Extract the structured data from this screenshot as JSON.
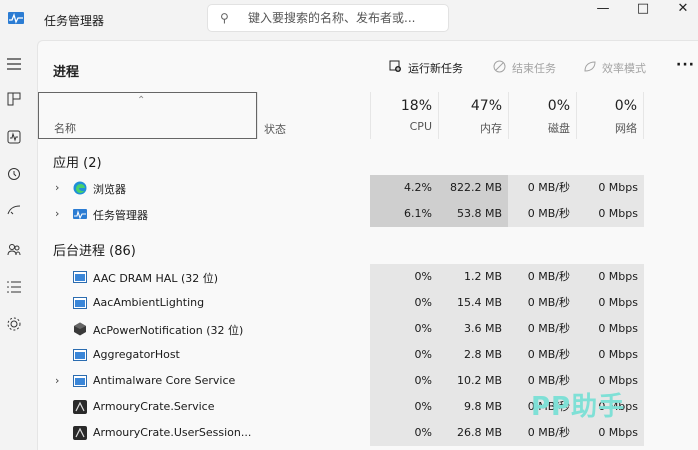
{
  "window": {
    "title": "任务管理器",
    "search_placeholder": "键入要搜索的名称、发布者或...",
    "minimize": "—",
    "maximize": "□",
    "close": "✕"
  },
  "nav_icons": [
    "hamburger-icon",
    "processes-icon",
    "performance-icon",
    "history-icon",
    "startup-icon",
    "users-icon",
    "details-icon",
    "services-icon"
  ],
  "page": {
    "title": "进程",
    "run_task": "运行新任务",
    "end_task": "结束任务",
    "efficiency": "效率模式",
    "more": "···"
  },
  "columns": {
    "name": "名称",
    "status": "状态",
    "cpu_pct": "18%",
    "cpu": "CPU",
    "mem_pct": "47%",
    "mem": "内存",
    "disk_pct": "0%",
    "disk": "磁盘",
    "net_pct": "0%",
    "net": "网络"
  },
  "groups": {
    "apps": "应用 (2)",
    "background": "后台进程 (86)"
  },
  "apps": [
    {
      "name": "浏览器",
      "cpu": "4.2%",
      "mem": "822.2 MB",
      "disk": "0 MB/秒",
      "net": "0 Mbps"
    },
    {
      "name": "任务管理器",
      "cpu": "6.1%",
      "mem": "53.8 MB",
      "disk": "0 MB/秒",
      "net": "0 Mbps"
    }
  ],
  "background": [
    {
      "name": "AAC DRAM HAL (32 位)",
      "cpu": "0%",
      "mem": "1.2 MB",
      "disk": "0 MB/秒",
      "net": "0 Mbps"
    },
    {
      "name": "AacAmbientLighting",
      "cpu": "0%",
      "mem": "15.4 MB",
      "disk": "0 MB/秒",
      "net": "0 Mbps"
    },
    {
      "name": "AcPowerNotification (32 位)",
      "cpu": "0%",
      "mem": "3.6 MB",
      "disk": "0 MB/秒",
      "net": "0 Mbps"
    },
    {
      "name": "AggregatorHost",
      "cpu": "0%",
      "mem": "2.8 MB",
      "disk": "0 MB/秒",
      "net": "0 Mbps"
    },
    {
      "name": "Antimalware Core Service",
      "cpu": "0%",
      "mem": "10.2 MB",
      "disk": "0 MB/秒",
      "net": "0 Mbps"
    },
    {
      "name": "ArmouryCrate.Service",
      "cpu": "0%",
      "mem": "9.8 MB",
      "disk": "0 MB/秒",
      "net": "0 Mbps"
    },
    {
      "name": "ArmouryCrate.UserSession...",
      "cpu": "0%",
      "mem": "26.8 MB",
      "disk": "0 MB/秒",
      "net": "0 Mbps"
    }
  ],
  "watermark": "PP助手"
}
